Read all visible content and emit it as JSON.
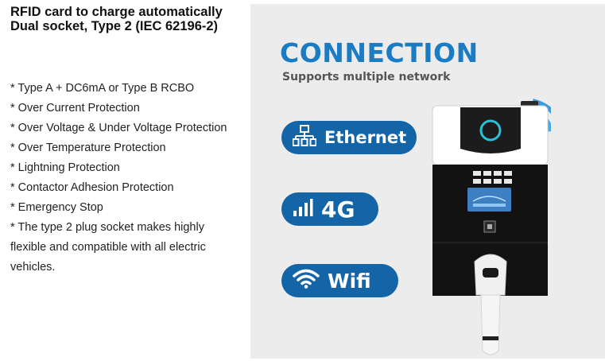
{
  "title": "RFID card to charge automatically\nDual socket, Type 2 (IEC 62196-2)",
  "features": [
    " * Type A + DC6mA or Type B RCBO",
    " * Over Current Protection",
    " * Over Voltage & Under Voltage Protection",
    " * Over Temperature Protection",
    " * Lightning Protection",
    " * Contactor Adhesion Protection",
    " * Emergency Stop",
    " * The type 2 plug socket makes highly flexible and compatible with all electric vehicles."
  ],
  "banner": {
    "headline": "CONNECTION",
    "subheadline": "Supports multiple network",
    "networks": [
      {
        "label": "Ethernet",
        "icon": "ethernet-icon"
      },
      {
        "label": "4G",
        "icon": "signal-bars-icon"
      },
      {
        "label": "Wifi",
        "icon": "wifi-icon"
      }
    ]
  },
  "colors": {
    "accent": "#1b7cc4",
    "pill": "#1464a8",
    "panel_bg": "#ececec"
  }
}
